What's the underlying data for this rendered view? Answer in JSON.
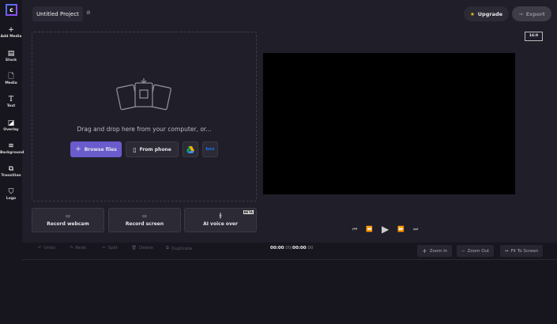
{
  "sidebar": {
    "items": [
      {
        "label": "Add Media",
        "icon": "plus-icon"
      },
      {
        "label": "Stock",
        "icon": "stock-icon"
      },
      {
        "label": "Media",
        "icon": "file-icon"
      },
      {
        "label": "Text",
        "icon": "text-icon"
      },
      {
        "label": "Overlay",
        "icon": "overlay-icon"
      },
      {
        "label": "Background",
        "icon": "layers-icon"
      },
      {
        "label": "Transition",
        "icon": "transition-icon"
      },
      {
        "label": "Logo",
        "icon": "shield-icon"
      }
    ]
  },
  "header": {
    "project_title": "Untitled Project",
    "upgrade": "Upgrade",
    "export": "Export",
    "aspect_ratio": "16:9"
  },
  "upload": {
    "prompt": "Drag and drop here from your computer, or...",
    "browse": "Browse files",
    "phone": "From phone",
    "box": "box"
  },
  "record": {
    "webcam": "Record webcam",
    "screen": "Record screen",
    "voice": "AI voice over",
    "beta": "BETA"
  },
  "timeline": {
    "undo": "Undo",
    "redo": "Redo",
    "split": "Split",
    "delete": "Delete",
    "duplicate": "Duplicate",
    "current_time": "00:00",
    "current_ms": ".00",
    "separator": " / ",
    "total_time": "00:00",
    "total_ms": ".00",
    "zoom_in": "Zoom In",
    "zoom_out": "Zoom Out",
    "fit": "Fit To Screen"
  },
  "colors": {
    "accent": "#6a5ccc",
    "background": "#1f1e29",
    "sidebar": "#17161e"
  }
}
